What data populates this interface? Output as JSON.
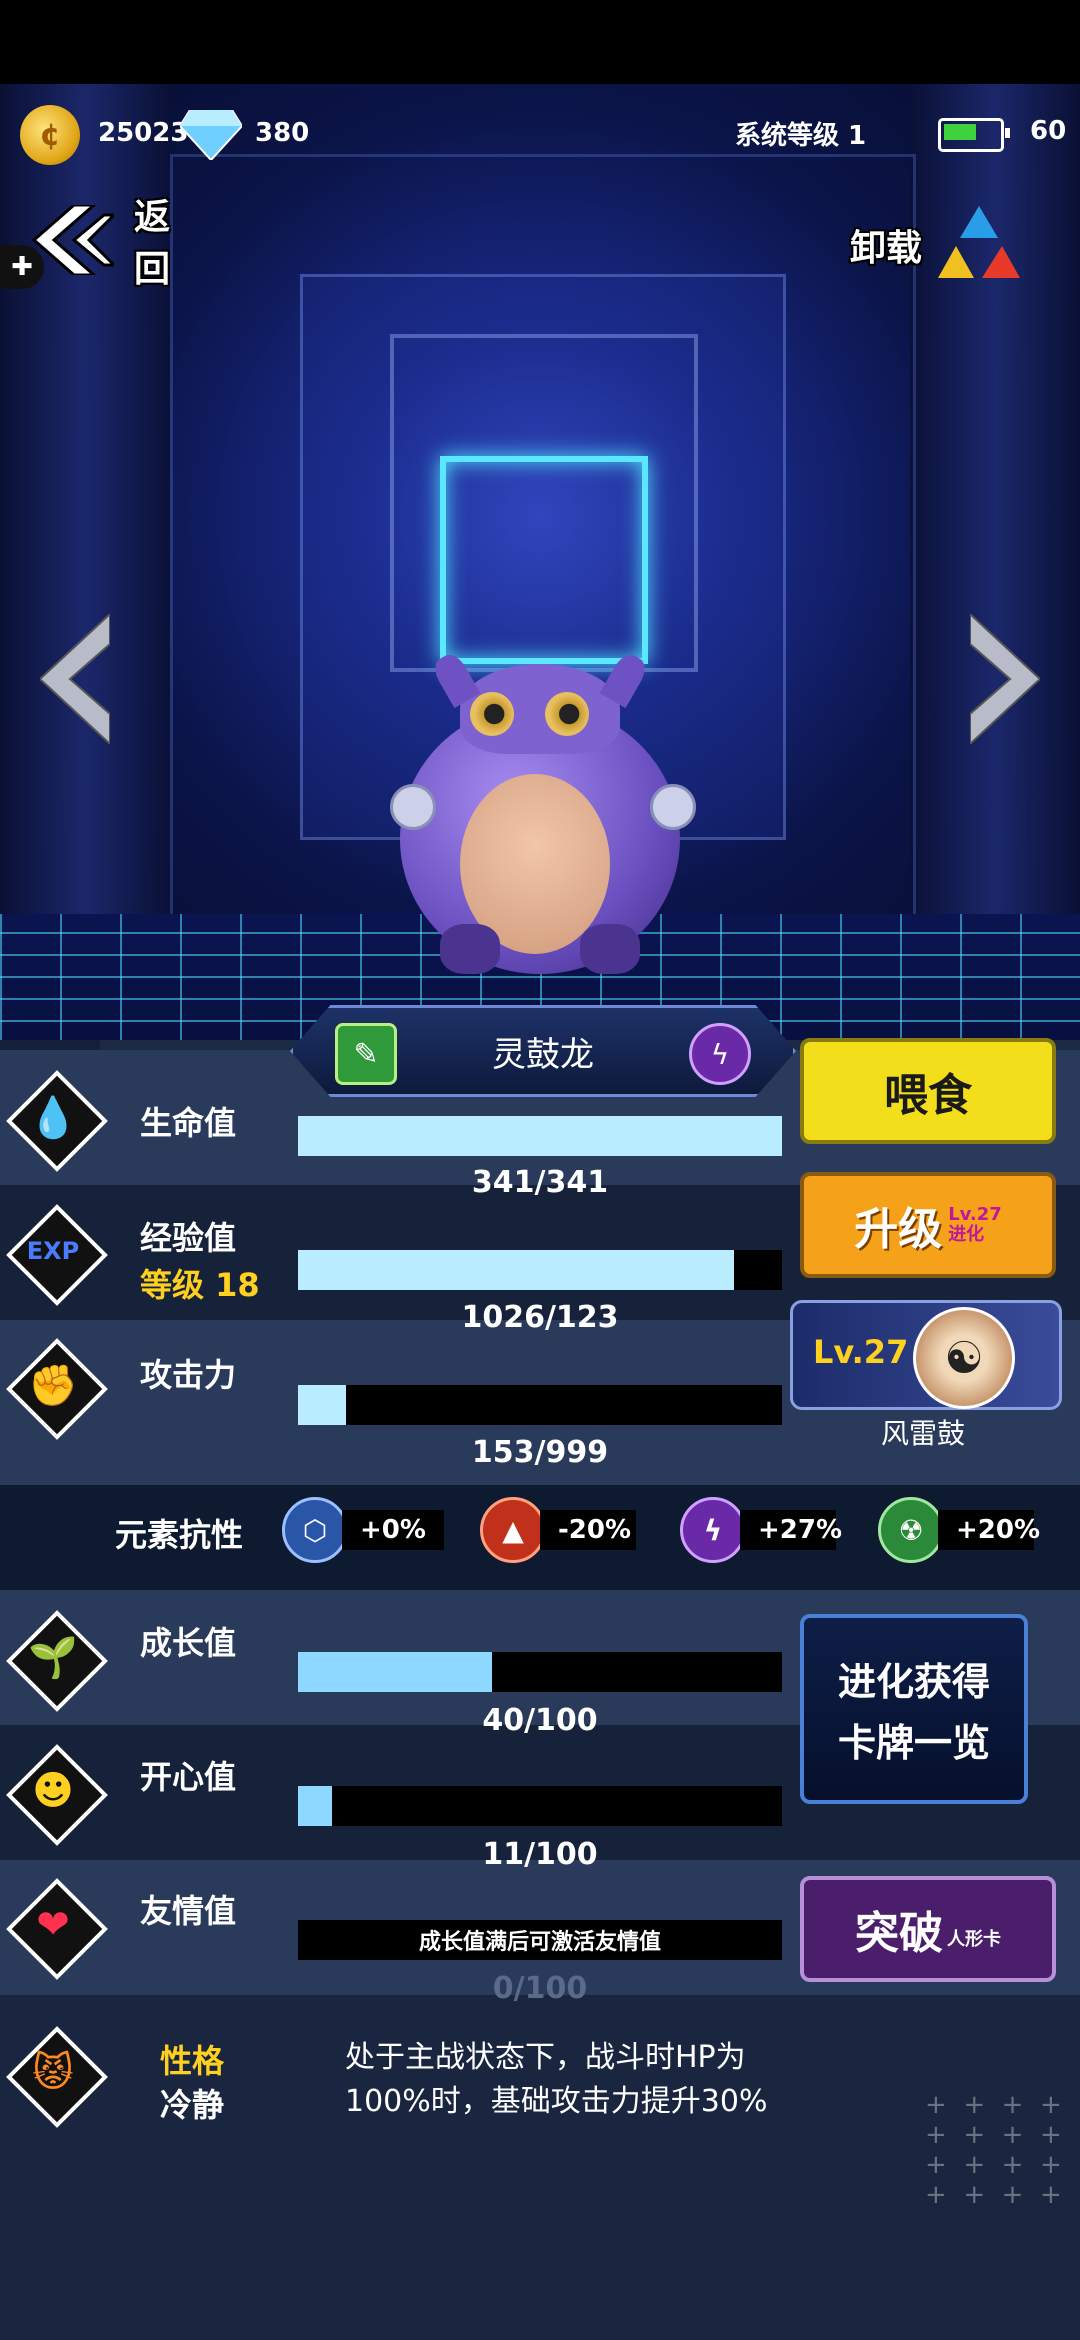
{
  "top": {
    "coins": "25023",
    "gems": "380",
    "system_level": "系统等级 1",
    "battery": "60",
    "back_label": "返回",
    "unload_label": "卸载"
  },
  "pet": {
    "name": "灵鼓龙"
  },
  "stats": {
    "hp": {
      "label": "生命值",
      "value": "341/341",
      "fill": 1.0
    },
    "exp": {
      "label": "经验值",
      "level": "等级 18",
      "value": "1026/123",
      "fill": 0.9
    },
    "attack": {
      "label": "攻击力",
      "value": "153/999",
      "fill": 0.153
    },
    "growth": {
      "label": "成长值",
      "value": "40/100",
      "fill": 0.4
    },
    "happy": {
      "label": "开心值",
      "value": "11/100",
      "fill": 0.11
    },
    "friend": {
      "label": "友情值",
      "note": "成长值满后可激活友情值",
      "value": "0/100"
    }
  },
  "resistance": {
    "label": "元素抗性",
    "items": [
      {
        "name": "hex-icon",
        "value": "+0%",
        "color": "#2a56a8"
      },
      {
        "name": "fire-icon",
        "value": "-20%",
        "color": "#c0301a"
      },
      {
        "name": "thunder-icon",
        "value": "+27%",
        "color": "#6a2aa8"
      },
      {
        "name": "toxic-icon",
        "value": "+20%",
        "color": "#2a8a3a"
      }
    ]
  },
  "buttons": {
    "feed": "喂食",
    "upgrade": "升级",
    "upgrade_tag_lv": "Lv.27",
    "upgrade_tag_evo": "进化",
    "skill_lv": "Lv.27",
    "skill_name": "风雷鼓",
    "evolve_cards_1": "进化获得",
    "evolve_cards_2": "卡牌一览",
    "breakthrough": "突破",
    "breakthrough_tag": "人形卡"
  },
  "personality": {
    "label": "性格",
    "value": "冷静",
    "desc": "处于主战状态下，战斗时HP为100%时，基础攻击力提升30%"
  },
  "colors": {
    "feed": "#f2de1a",
    "upgrade": "#f5a21a",
    "breakthrough": "#4a1e6a",
    "bar_fill": "#b9ecff"
  }
}
